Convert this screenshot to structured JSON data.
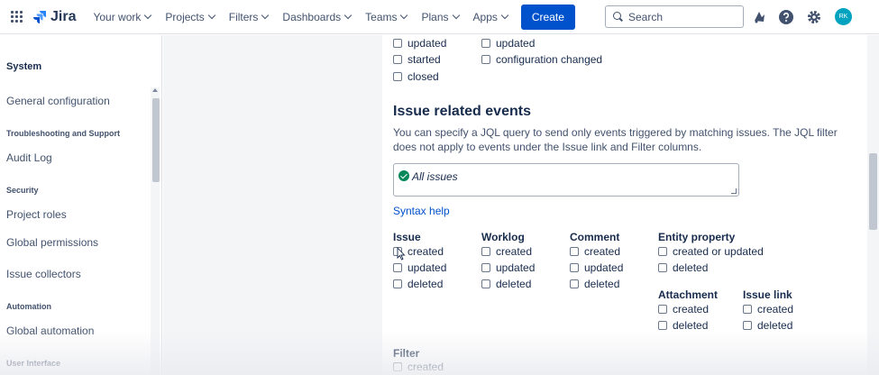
{
  "nav": {
    "logo": "Jira",
    "items": [
      {
        "label": "Your work"
      },
      {
        "label": "Projects"
      },
      {
        "label": "Filters"
      },
      {
        "label": "Dashboards"
      },
      {
        "label": "Teams"
      },
      {
        "label": "Plans"
      },
      {
        "label": "Apps"
      }
    ],
    "create": "Create",
    "search_placeholder": "Search",
    "avatar_initials": "RK"
  },
  "sidebar": {
    "section": "System",
    "general_configuration": "General configuration",
    "troubleshooting_header": "Troubleshooting and Support",
    "audit_log": "Audit Log",
    "security_header": "Security",
    "project_roles": "Project roles",
    "global_permissions": "Global permissions",
    "issue_collectors": "Issue collectors",
    "automation_header": "Automation",
    "global_automation": "Global automation",
    "user_interface_header": "User Interface"
  },
  "top_events": {
    "col1": [
      "updated",
      "started",
      "closed"
    ],
    "col2": [
      "updated",
      "configuration changed"
    ]
  },
  "issue_related": {
    "title": "Issue related events",
    "description": "You can specify a JQL query to send only events triggered by matching issues. The JQL filter does not apply to events under the Issue link and Filter columns.",
    "jql_value": "All issues",
    "syntax_help": "Syntax help",
    "issue": {
      "header": "Issue",
      "items": [
        "created",
        "updated",
        "deleted"
      ]
    },
    "worklog": {
      "header": "Worklog",
      "items": [
        "created",
        "updated",
        "deleted"
      ]
    },
    "comment": {
      "header": "Comment",
      "items": [
        "created",
        "updated",
        "deleted"
      ]
    },
    "entity_property": {
      "header": "Entity property",
      "items": [
        "created or updated",
        "deleted"
      ]
    },
    "attachment": {
      "header": "Attachment",
      "items": [
        "created",
        "deleted"
      ]
    },
    "issue_link": {
      "header": "Issue link",
      "items": [
        "created",
        "deleted"
      ]
    },
    "filter": {
      "header": "Filter",
      "items": [
        "created"
      ]
    }
  },
  "colors": {
    "brand": "#0052cc",
    "text": "#172b4d",
    "success": "#00875a",
    "avatar": "#00a3bf"
  }
}
